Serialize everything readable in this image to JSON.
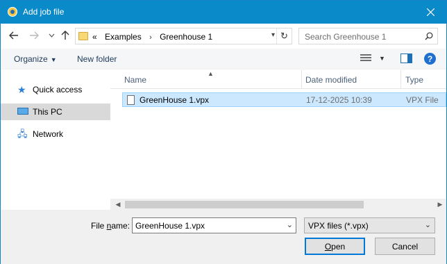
{
  "window": {
    "title": "Add job file"
  },
  "nav": {
    "back_icon": "arrow-left",
    "forward_icon": "arrow-right",
    "recent_icon": "chevron-down",
    "up_icon": "arrow-up"
  },
  "address": {
    "overflow": "«",
    "crumbs": [
      "Examples",
      "Greenhouse 1"
    ],
    "refresh_icon": "refresh"
  },
  "search": {
    "placeholder": "Search Greenhouse 1"
  },
  "toolbar": {
    "organize": "Organize",
    "new_folder": "New folder"
  },
  "sidebar": {
    "items": [
      {
        "label": "Quick access",
        "icon": "star-icon"
      },
      {
        "label": "This PC",
        "icon": "computer-icon",
        "selected": true
      },
      {
        "label": "Network",
        "icon": "network-icon"
      }
    ]
  },
  "columns": [
    "Name",
    "Date modified",
    "Type"
  ],
  "files": [
    {
      "name": "GreenHouse 1.vpx",
      "date": "17-12-2025 10:39",
      "type": "VPX File"
    }
  ],
  "footer": {
    "file_name_label_pre": "File ",
    "file_name_label_u": "n",
    "file_name_label_post": "ame:",
    "file_name_value": "GreenHouse 1.vpx",
    "file_type": "VPX files (*.vpx)",
    "open_u": "O",
    "open_rest": "pen",
    "cancel": "Cancel"
  },
  "colors": {
    "titlebar": "#0a8ac8",
    "selection": "#cce8ff",
    "accent": "#0078d7"
  }
}
